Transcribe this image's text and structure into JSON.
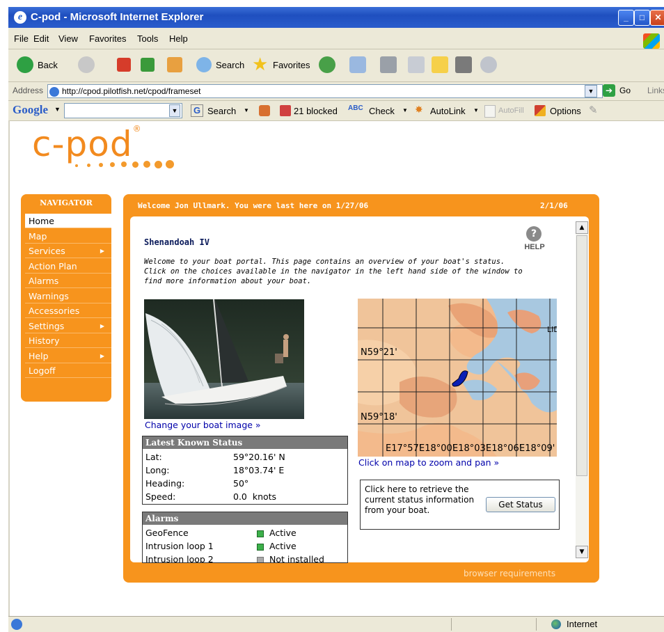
{
  "window": {
    "title": "C-pod - Microsoft Internet Explorer"
  },
  "menu": [
    "File",
    "Edit",
    "View",
    "Favorites",
    "Tools",
    "Help"
  ],
  "toolbar": {
    "back": "Back",
    "search": "Search",
    "favorites": "Favorites"
  },
  "address": {
    "label": "Address",
    "url": "http://cpod.pilotfish.net/cpod/frameset",
    "go": "Go",
    "links": "Links"
  },
  "google": {
    "logo": "Google",
    "search": "Search",
    "blocked": "21 blocked",
    "check": "Check",
    "autolink": "AutoLink",
    "autofill": "AutoFill",
    "options": "Options"
  },
  "statusbar": {
    "zone": "Internet"
  },
  "logo": {
    "text": "c-pod",
    "mark": "®"
  },
  "nav": {
    "header": "NAVIGATOR",
    "items": [
      {
        "label": "Home",
        "selected": true
      },
      {
        "label": "Map"
      },
      {
        "label": "Services",
        "arrow": "▶"
      },
      {
        "label": "Action Plan"
      },
      {
        "label": "Alarms"
      },
      {
        "label": "Warnings"
      },
      {
        "label": "Accessories"
      },
      {
        "label": "Settings",
        "arrow": "▶"
      },
      {
        "label": "History"
      },
      {
        "label": "Help",
        "arrow": "▶"
      },
      {
        "label": "Logoff"
      }
    ]
  },
  "panel": {
    "welcome": "Welcome Jon Ullmark. You were last here on 1/27/06",
    "date": "2/1/06",
    "boat_name": "Shenandoah IV",
    "help_label": "HELP",
    "intro": "Welcome to your boat portal. This page contains an overview of your boat's status. Click on the choices available in the navigator in the left hand side of the window to find more information about your boat.",
    "change_image_link": "Change your boat image »",
    "browser_requirements": "browser requirements"
  },
  "status": {
    "title": "Latest Known Status",
    "rows": [
      {
        "label": "Lat:",
        "value": "59°20.16' N"
      },
      {
        "label": "Long:",
        "value": "18°03.74' E"
      },
      {
        "label": "Heading:",
        "value": "50°"
      },
      {
        "label": "Speed:",
        "value": "0.0  knots"
      }
    ]
  },
  "alarms": {
    "title": "Alarms",
    "rows": [
      {
        "label": "GeoFence",
        "state": "Active"
      },
      {
        "label": "Intrusion loop 1",
        "state": "Active"
      },
      {
        "label": "Intrusion loop 2",
        "state": "Not installed"
      }
    ]
  },
  "map": {
    "lat_labels": [
      "N59°21'",
      "N59°18'"
    ],
    "lon_labels": [
      "E17°57'",
      "E18°00'",
      "E18°03'",
      "E18°06'",
      "E18°09'"
    ],
    "town_label": "LID",
    "link": "Click on map to zoom and pan »"
  },
  "get_status": {
    "text": "Click here to retrieve the current status information from your boat.",
    "button": "Get Status"
  },
  "colors": {
    "accent": "#f7941d",
    "status_header": "#7a7a7a",
    "alarm_active": "#3cb04a"
  }
}
